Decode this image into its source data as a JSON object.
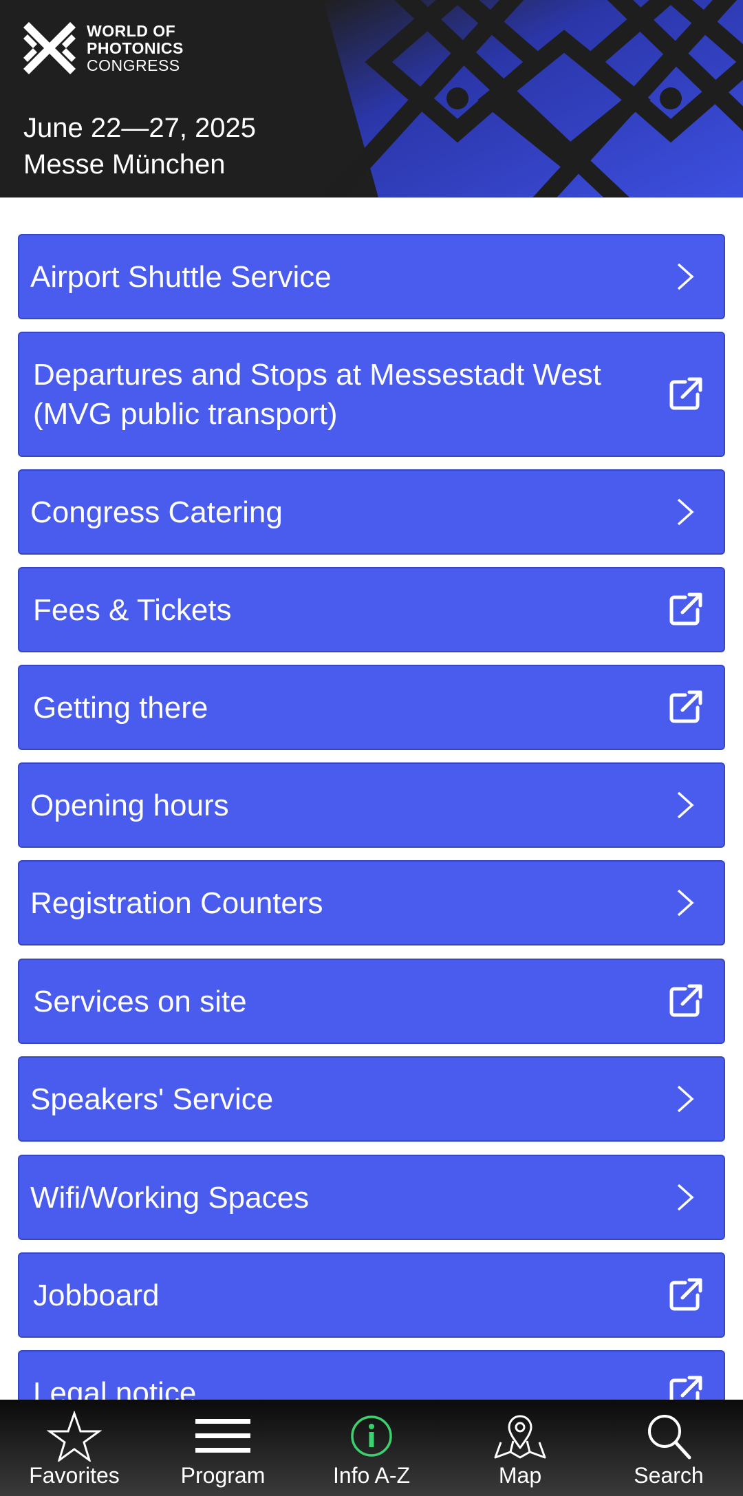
{
  "header": {
    "logo_line1": "WORLD OF",
    "logo_line2": "PHOTONICS",
    "logo_line3": "CONGRESS",
    "dates": "June 22—27, 2025",
    "venue": "Messe München"
  },
  "items": [
    {
      "label": "Airport Shuttle Service",
      "icon": "chevron-right-icon"
    },
    {
      "label_line1": "Departures and Stops at Messestadt West",
      "label_line2": "(MVG public transport)",
      "icon": "external-link-icon"
    },
    {
      "label": "Congress Catering",
      "icon": "chevron-right-icon"
    },
    {
      "label": "Fees & Tickets",
      "icon": "external-link-icon"
    },
    {
      "label": "Getting there",
      "icon": "external-link-icon"
    },
    {
      "label": "Opening hours",
      "icon": "chevron-right-icon"
    },
    {
      "label": "Registration Counters",
      "icon": "chevron-right-icon"
    },
    {
      "label": "Services on site",
      "icon": "external-link-icon"
    },
    {
      "label": "Speakers' Service",
      "icon": "chevron-right-icon"
    },
    {
      "label": "Wifi/Working Spaces",
      "icon": "chevron-right-icon"
    },
    {
      "label": "Jobboard",
      "icon": "external-link-icon"
    },
    {
      "label": "Legal notice",
      "icon": "external-link-icon"
    }
  ],
  "nav": [
    {
      "label": "Favorites",
      "icon": "star-icon"
    },
    {
      "label": "Program",
      "icon": "menu-icon"
    },
    {
      "label": "Info A-Z",
      "icon": "info-icon",
      "active": true
    },
    {
      "label": "Map",
      "icon": "map-pin-icon"
    },
    {
      "label": "Search",
      "icon": "search-icon"
    }
  ],
  "colors": {
    "item_bg": "#4a5ced",
    "banner_bg": "#1f1f1f",
    "accent_blue": "#3d4fe0",
    "active_nav_icon": "#3bd16f"
  }
}
